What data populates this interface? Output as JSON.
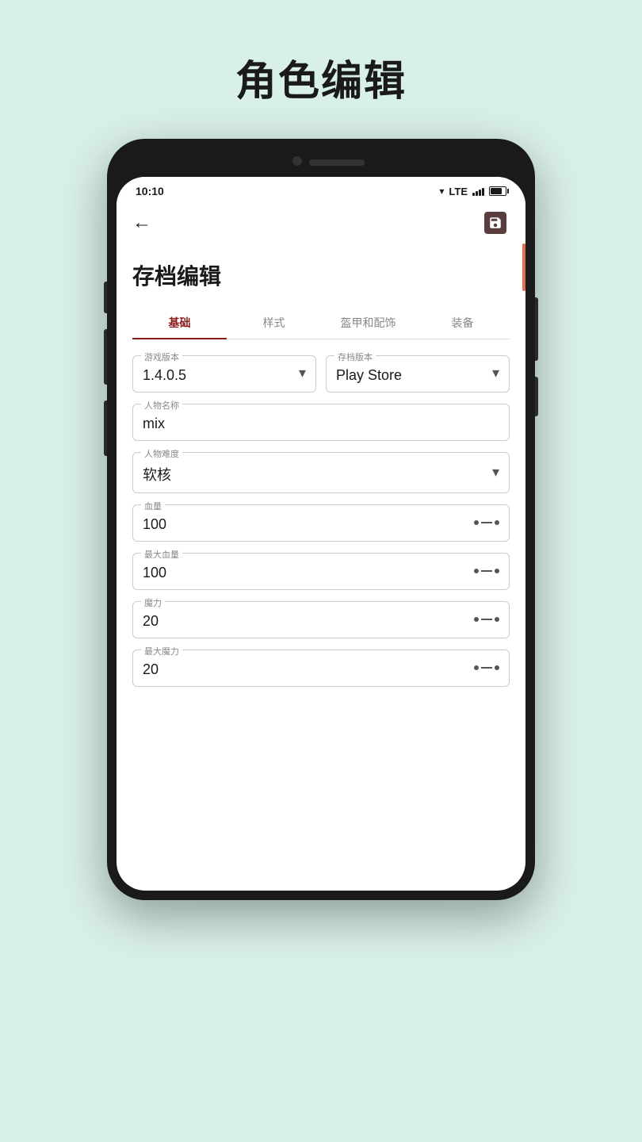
{
  "page": {
    "title": "角色编辑",
    "background": "#d9f0e8"
  },
  "status_bar": {
    "time": "10:10",
    "lte": "LTE"
  },
  "app_bar": {
    "back_label": "←",
    "save_label": "💾"
  },
  "screen": {
    "title": "存档编辑",
    "tabs": [
      {
        "label": "基础",
        "active": true
      },
      {
        "label": "样式",
        "active": false
      },
      {
        "label": "盔甲和配饰",
        "active": false
      },
      {
        "label": "装备",
        "active": false
      }
    ],
    "form": {
      "game_version": {
        "label": "游戏版本",
        "value": "1.4.0.5"
      },
      "save_version": {
        "label": "存档版本",
        "value": "Play Store"
      },
      "character_name": {
        "label": "人物名称",
        "value": "mix"
      },
      "difficulty": {
        "label": "人物难度",
        "value": "软核"
      },
      "health": {
        "label": "血量",
        "value": "100"
      },
      "max_health": {
        "label": "最大血量",
        "value": "100"
      },
      "mana": {
        "label": "魔力",
        "value": "20"
      },
      "max_mana": {
        "label": "最大魔力",
        "value": "20"
      }
    }
  }
}
